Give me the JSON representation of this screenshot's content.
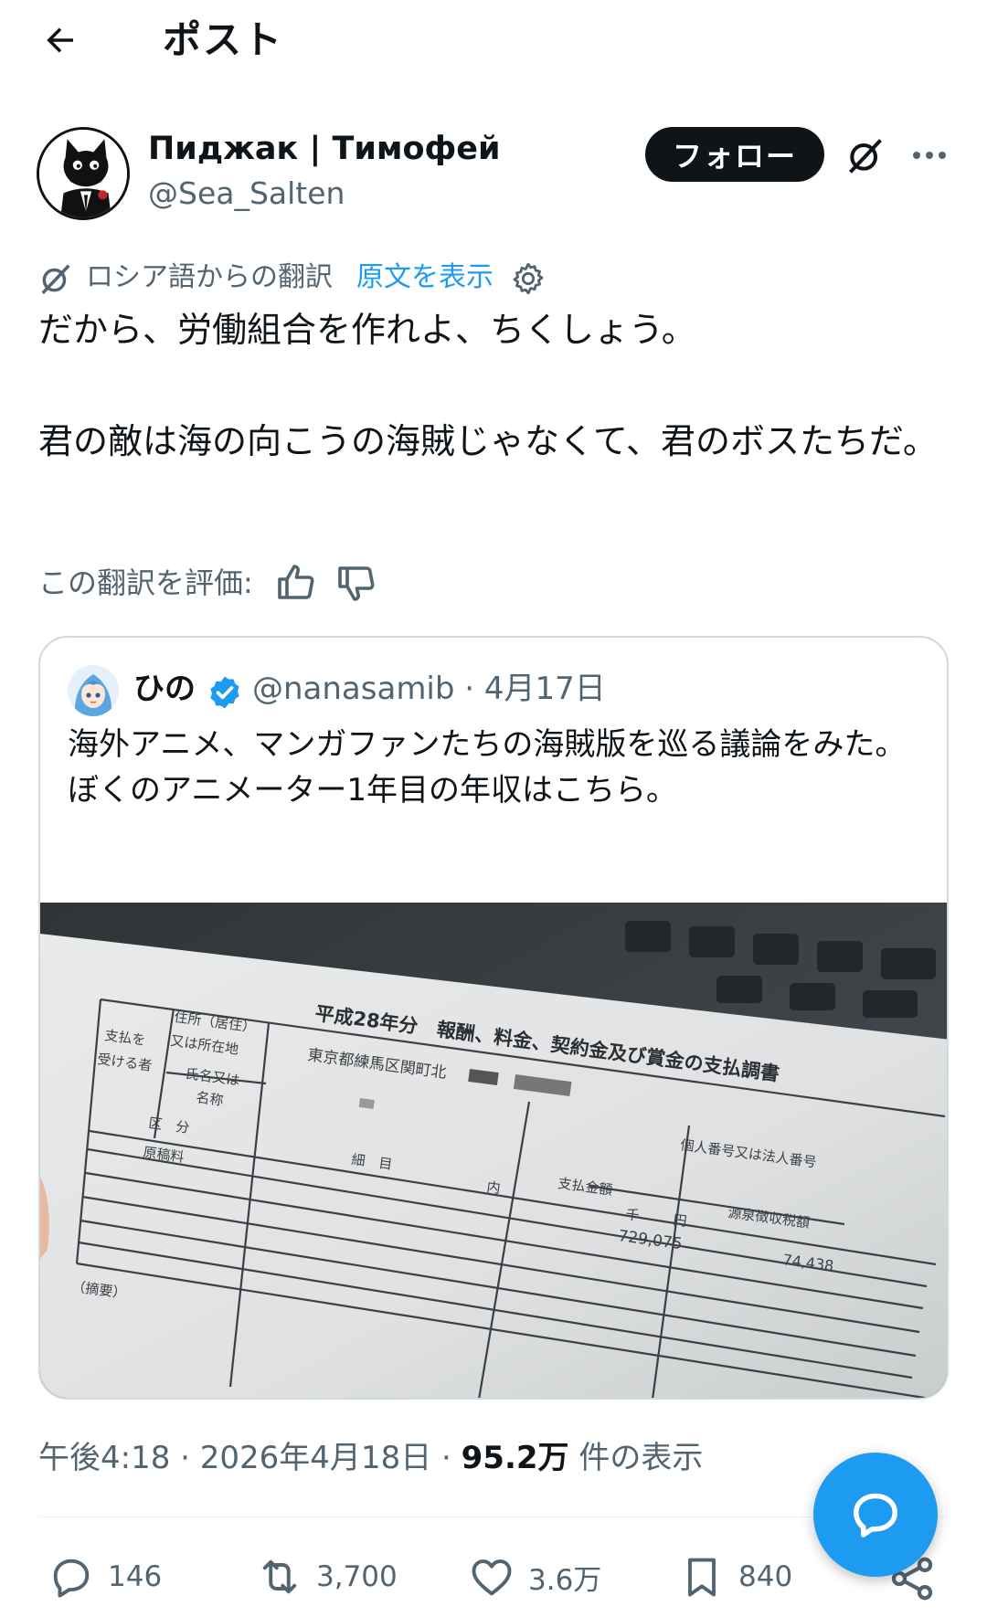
{
  "header": {
    "title": "ポスト",
    "back_icon": "arrow-left-icon"
  },
  "author": {
    "name": "Пиджак | Тимофей",
    "handle": "@Sea_Salten",
    "follow_label": "フォロー"
  },
  "translation": {
    "label": "ロシア語からの翻訳",
    "show_original": "原文を表示"
  },
  "post": {
    "line1": "だから、労働組合を作れよ、ちくしょう。",
    "line2": "君の敵は海の向こうの海賊じゃなくて、君のボスたちだ。"
  },
  "rating": {
    "label": "この翻訳を評価:"
  },
  "quote": {
    "name": "ひの",
    "handle": "@nanasamib · 4月17日",
    "text": "海外アニメ、マンガファンたちの海賊版を巡る議論をみた。\nぼくのアニメーター1年目の年収はこちら。",
    "image": {
      "title": "平成28年分　報酬、料金、契約金及び賞金の支払調書",
      "address": "東京都練馬区関町北",
      "row_payer_1": "支払を",
      "row_payer_2": "受ける者",
      "row_address_1": "住所（居住）",
      "row_address_2": "又は所在地",
      "row_name_1": "氏名又は",
      "row_name_2": "名称",
      "kubun": "区　分",
      "saimoku": "細　目",
      "genkoryo": "原稿料",
      "shiharai": "支払金額",
      "gensen": "源泉徴収税額",
      "kojin": "個人番号又は法人番号",
      "uchi": "内",
      "sen": "千",
      "en": "円",
      "amount": "729,075",
      "tax": "74,438",
      "tekiyo": "（摘要）"
    }
  },
  "meta": {
    "time": "午後4:18 · 2026年4月18日 · ",
    "views": "95.2万",
    "views_suffix": " 件の表示"
  },
  "actions": {
    "replies": "146",
    "reposts": "3,700",
    "likes": "3.6万",
    "bookmarks": "840"
  },
  "colors": {
    "accent": "#1d9bf0",
    "text": "#0f1419",
    "muted": "#536471"
  }
}
